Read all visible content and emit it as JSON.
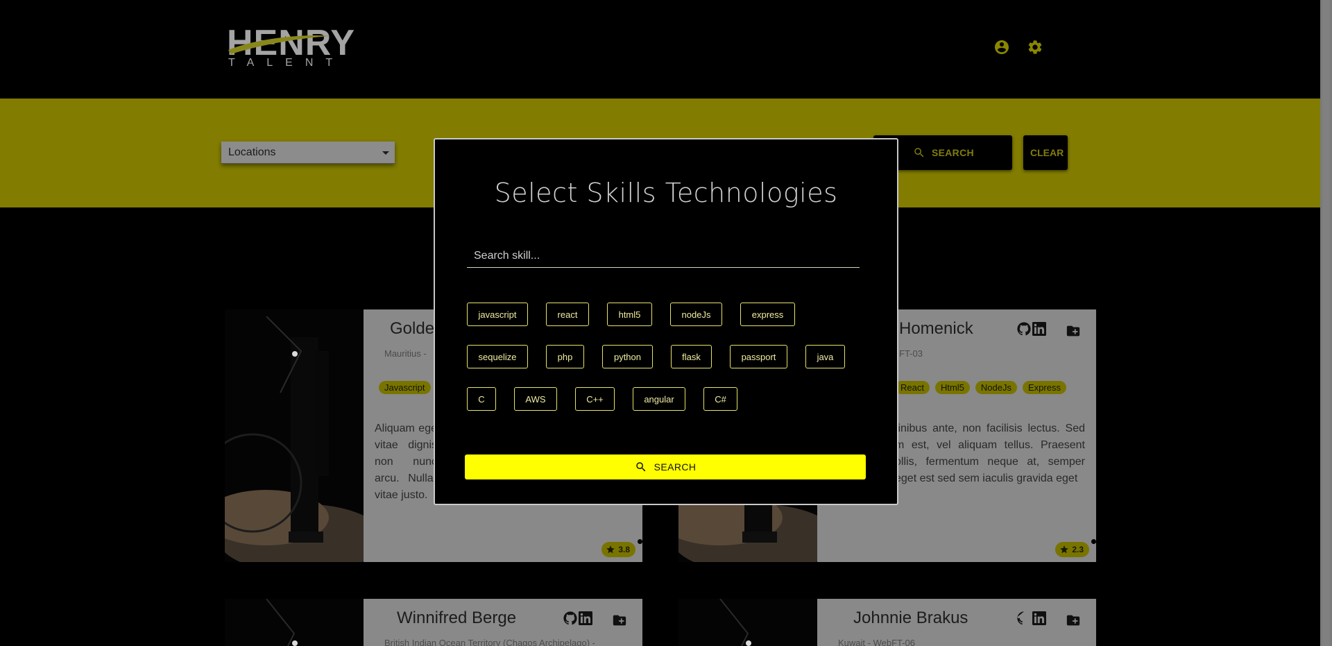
{
  "header": {
    "logo_word": "HENRY",
    "logo_sub": "TALENT",
    "icons": [
      "account-circle-icon",
      "gear-icon"
    ]
  },
  "filters": {
    "locations_label": "Locations",
    "search_label": "SEARCH",
    "clear_label": "CLEAR"
  },
  "cards": [
    {
      "name": "Golde",
      "meta": "Mauritius -",
      "tags": [
        "Javascript"
      ],
      "description": "Aliquam ege vitae dignis non nunc arcu. Nullar vitae justo.",
      "rating": "3.8"
    },
    {
      "name": "Homenick",
      "meta": "FT-03",
      "tags": [
        "React",
        "Html5",
        "NodeJs",
        "Express"
      ],
      "description": "finibus ante, non facilisis lectus. Sed m est, vel aliquam tellus. Praesent ollis, fermentum neque at, semper eget est sed sem iaculis gravida eget",
      "rating": "2.3"
    },
    {
      "name": "Winnifred Berge",
      "meta": "British Indian Ocean Territory (Chagos Archipelago) -"
    },
    {
      "name": "Johnnie Brakus",
      "meta": "Kuwait - WebFT-06"
    }
  ],
  "modal": {
    "title": "Select Skills Technologies",
    "search_placeholder": "Search skill...",
    "skills": [
      "javascript",
      "react",
      "html5",
      "nodeJs",
      "express",
      "sequelize",
      "php",
      "python",
      "flask",
      "passport",
      "java",
      "C",
      "AWS",
      "C++",
      "angular",
      "C#"
    ],
    "search_button": "SEARCH"
  },
  "colors": {
    "accent": "#ffff00",
    "band": "#857f00",
    "tag": "#7c7700"
  }
}
